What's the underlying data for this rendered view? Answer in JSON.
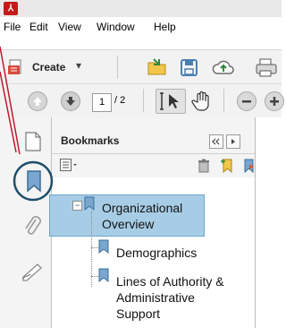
{
  "menu": {
    "items": [
      "File",
      "Edit",
      "View",
      "Window",
      "Help"
    ]
  },
  "toolbar": {
    "create_label": "Create",
    "create_dropdown": "▾",
    "page_number": "1",
    "page_total": "/ 2"
  },
  "panel": {
    "title": "Bookmarks"
  },
  "bookmarks": [
    {
      "lines": [
        "Organizational",
        "Overview"
      ],
      "selected": true,
      "expanded": true,
      "level": 0
    },
    {
      "lines": [
        "Demographics"
      ],
      "selected": false,
      "level": 1
    },
    {
      "lines": [
        "Lines of Authority &",
        "Administrative",
        "Support"
      ],
      "selected": false,
      "level": 1
    }
  ],
  "colors": {
    "accent_red": "#c0192f",
    "callout_circle": "#1f4e6b",
    "selection_bg": "#a7cde6",
    "bookmark_icon": "#3a6f9a"
  },
  "icons": [
    "app-icon",
    "create-pdf-icon",
    "open-folder-icon",
    "save-icon",
    "upload-cloud-icon",
    "print-icon",
    "prev-page-icon",
    "next-page-icon",
    "select-cursor-icon",
    "hand-tool-icon",
    "zoom-out-icon",
    "zoom-in-icon",
    "pages-icon",
    "bookmarks-icon",
    "attachments-icon",
    "signatures-icon",
    "options-menu-icon",
    "delete-icon",
    "new-bookmark-icon",
    "expand-bookmark-icon",
    "panel-collapse-icon",
    "panel-expand-icon"
  ]
}
